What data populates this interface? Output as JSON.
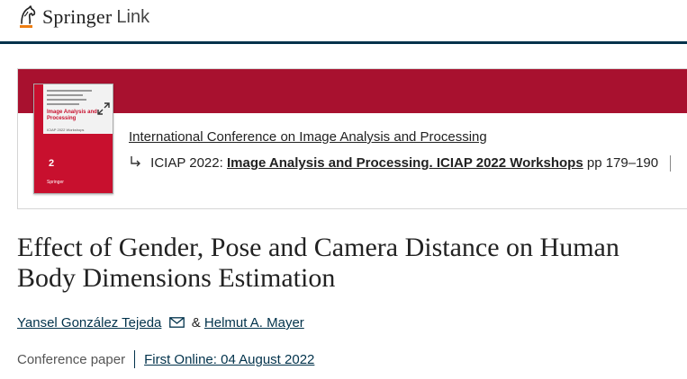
{
  "header": {
    "brand_primary": "Springer",
    "brand_secondary": "Link"
  },
  "conference": {
    "name": "International Conference on Image Analysis and Processing",
    "series_prefix": "ICIAP 2022:",
    "book_title": "Image Analysis and Processing. ICIAP 2022 Workshops",
    "pages": "pp 179–190",
    "cover": {
      "title": "Image Analysis and Processing",
      "subtitle": "ICIAP 2022 Workshops",
      "volume": "2",
      "publisher": "Springer"
    }
  },
  "article": {
    "title": "Effect of Gender, Pose and Camera Distance on Human Body Dimensions Estimation",
    "authors": [
      {
        "name": "Yansel González Tejeda",
        "has_email": true
      },
      {
        "name": "Helmut A. Mayer",
        "has_email": false
      }
    ],
    "author_separator": "&",
    "content_type": "Conference paper",
    "first_online": "First Online: 04 August 2022"
  },
  "colors": {
    "band": "#a8112f",
    "navy": "#01324b",
    "logo_orange": "#ee7d11"
  }
}
